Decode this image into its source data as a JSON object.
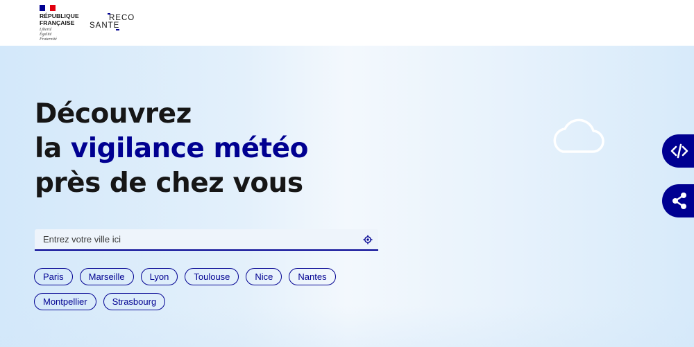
{
  "header": {
    "gov_lines": [
      "RÉPUBLIQUE",
      "FRANÇAISE"
    ],
    "motto": [
      "Liberté",
      "Égalité",
      "Fraternité"
    ],
    "brand_top": "RECO",
    "brand_bottom": "SANTE",
    "flag_colors": [
      "#000091",
      "#ffffff",
      "#e1000f"
    ]
  },
  "hero": {
    "line1": "Découvrez",
    "line2_article": "la",
    "line2_accent": "vigilance météo",
    "line3": "près de chez vous",
    "accent_color": "#000091"
  },
  "search": {
    "placeholder": "Entrez votre ville ici",
    "locate_icon": "crosshair-icon"
  },
  "cities": {
    "row1": [
      "Paris",
      "Marseille",
      "Lyon",
      "Toulouse",
      "Nice",
      "Nantes"
    ],
    "row2": [
      "Montpellier",
      "Strasbourg"
    ]
  },
  "side_buttons": {
    "embed_icon": "code-icon",
    "share_icon": "share-icon"
  },
  "decor": {
    "cloud_icon": "cloud-icon"
  }
}
